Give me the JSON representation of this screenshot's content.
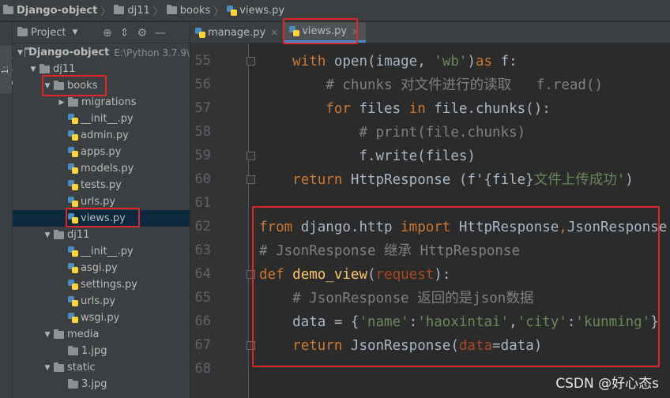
{
  "breadcrumb": [
    "Django-object",
    "dj11",
    "books",
    "views.py"
  ],
  "sidebar_strip": {
    "label": "1: Project"
  },
  "project_panel": {
    "title": "Project",
    "tree": [
      {
        "label": "Django-object",
        "suffix": "E:\\Python 3.7.9\\",
        "kind": "folder",
        "expanded": true,
        "depth": 0
      },
      {
        "label": "dj11",
        "kind": "folder",
        "expanded": true,
        "depth": 1
      },
      {
        "label": "books",
        "kind": "folder",
        "expanded": true,
        "depth": 2
      },
      {
        "label": "migrations",
        "kind": "folder",
        "expanded": false,
        "depth": 3
      },
      {
        "label": "__init__.py",
        "kind": "py",
        "depth": 3
      },
      {
        "label": "admin.py",
        "kind": "py",
        "depth": 3
      },
      {
        "label": "apps.py",
        "kind": "py",
        "depth": 3
      },
      {
        "label": "models.py",
        "kind": "py",
        "depth": 3
      },
      {
        "label": "tests.py",
        "kind": "py",
        "depth": 3
      },
      {
        "label": "urls.py",
        "kind": "py",
        "depth": 3
      },
      {
        "label": "views.py",
        "kind": "py",
        "depth": 3,
        "selected": true
      },
      {
        "label": "dj11",
        "kind": "folder",
        "expanded": true,
        "depth": 2
      },
      {
        "label": "__init__.py",
        "kind": "py",
        "depth": 3
      },
      {
        "label": "asgi.py",
        "kind": "py",
        "depth": 3
      },
      {
        "label": "settings.py",
        "kind": "py",
        "depth": 3
      },
      {
        "label": "urls.py",
        "kind": "py",
        "depth": 3
      },
      {
        "label": "wsgi.py",
        "kind": "py",
        "depth": 3
      },
      {
        "label": "media",
        "kind": "folder",
        "expanded": true,
        "depth": 2
      },
      {
        "label": "1.jpg",
        "kind": "file",
        "depth": 3
      },
      {
        "label": "static",
        "kind": "folder",
        "expanded": true,
        "depth": 2
      },
      {
        "label": "3.jpg",
        "kind": "file",
        "depth": 3
      }
    ]
  },
  "editor_tabs": [
    {
      "label": "manage.py",
      "active": false
    },
    {
      "label": "views.py",
      "active": true
    }
  ],
  "code_lines": [
    {
      "num": "55",
      "tokens": [
        [
          "    ",
          ""
        ],
        [
          "with",
          "kw"
        ],
        [
          " open(image, ",
          ""
        ],
        [
          "'wb'",
          "st"
        ],
        [
          ")",
          ""
        ],
        [
          "as",
          "kw"
        ],
        [
          " f:",
          ""
        ]
      ]
    },
    {
      "num": "56",
      "tokens": [
        [
          "        ",
          ""
        ],
        [
          "# chunks 对文件进行的读取   f.read()",
          "cm"
        ]
      ]
    },
    {
      "num": "57",
      "tokens": [
        [
          "        ",
          ""
        ],
        [
          "for",
          "kw"
        ],
        [
          " files ",
          ""
        ],
        [
          "in",
          "kw"
        ],
        [
          " file.chunks():",
          ""
        ]
      ]
    },
    {
      "num": "58",
      "tokens": [
        [
          "            ",
          ""
        ],
        [
          "# print(file.chunks)",
          "cm"
        ]
      ]
    },
    {
      "num": "59",
      "tokens": [
        [
          "            f.write(files)",
          ""
        ]
      ]
    },
    {
      "num": "60",
      "tokens": [
        [
          "    ",
          ""
        ],
        [
          "return",
          "kw"
        ],
        [
          " HttpResponse ",
          ""
        ],
        [
          "(f'",
          ""
        ],
        [
          "{file}",
          ""
        ],
        [
          "文件上传成功'",
          "st"
        ],
        [
          ")",
          ""
        ]
      ]
    },
    {
      "num": "61",
      "tokens": []
    },
    {
      "num": "62",
      "tokens": [
        [
          "from",
          "kw"
        ],
        [
          " django.http ",
          ""
        ],
        [
          "import",
          "kw"
        ],
        [
          " HttpResponse",
          ""
        ],
        [
          ",",
          "kw"
        ],
        [
          "JsonResponse",
          ""
        ]
      ]
    },
    {
      "num": "63",
      "tokens": [
        [
          "# JsonResponse 继承 HttpResponse",
          "cm"
        ]
      ]
    },
    {
      "num": "64",
      "tokens": [
        [
          "def",
          "kw"
        ],
        [
          " ",
          ""
        ],
        [
          "demo_view",
          "fn"
        ],
        [
          "(",
          ""
        ],
        [
          "request",
          "par"
        ],
        [
          "):",
          ""
        ]
      ]
    },
    {
      "num": "65",
      "tokens": [
        [
          "    ",
          ""
        ],
        [
          "# JsonResponse 返回的是json数据",
          "cm"
        ]
      ]
    },
    {
      "num": "66",
      "tokens": [
        [
          "    data = {",
          ""
        ],
        [
          "'name'",
          "st"
        ],
        [
          ":",
          ""
        ],
        [
          "'haoxintai'",
          "st"
        ],
        [
          ",",
          ""
        ],
        [
          "'city'",
          "st"
        ],
        [
          ":",
          ""
        ],
        [
          "'kunming'",
          "st"
        ],
        [
          "}",
          ""
        ]
      ]
    },
    {
      "num": "67",
      "tokens": [
        [
          "    ",
          ""
        ],
        [
          "return",
          "kw"
        ],
        [
          " JsonResponse(",
          ""
        ],
        [
          "data",
          "par"
        ],
        [
          "=data)",
          ""
        ]
      ]
    },
    {
      "num": "68",
      "tokens": []
    }
  ],
  "watermark": "CSDN @好心态s",
  "colors": {
    "highlight_box": "#e0262b",
    "keyword": "#cc7832",
    "string": "#6a8759",
    "comment": "#808080",
    "function": "#ffc66d"
  }
}
